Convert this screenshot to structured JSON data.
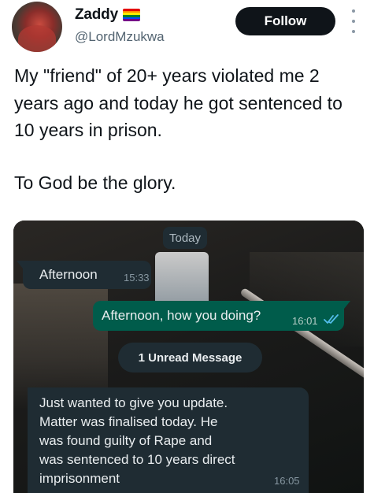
{
  "user": {
    "display_name": "Zaddy",
    "handle": "@LordMzukwa",
    "flag_icon": "rainbow-flag-icon",
    "flag_colors": [
      "#e40303",
      "#ff8c00",
      "#ffed00",
      "#008026",
      "#004dff",
      "#750787"
    ]
  },
  "actions": {
    "follow_label": "Follow",
    "more_icon": "more-vertical-icon"
  },
  "tweet": {
    "line1": "My \"friend\" of 20+ years violated me 2 years ago and today he got sentenced to 10 years in prison.",
    "line2": "To God be the glory."
  },
  "chat": {
    "date_chip": "Today",
    "messages": [
      {
        "direction": "incoming",
        "text": "Afternoon",
        "time": "15:33"
      },
      {
        "direction": "outgoing",
        "text": "Afternoon, how you doing?",
        "time": "16:01",
        "status_icon": "double-check-read-icon"
      },
      {
        "direction": "incoming",
        "text": "Just wanted to give you update.\nMatter was finalised today. He\nwas found guilty of Rape and\nwas sentenced to 10 years direct\nimprisonment",
        "time": "16:05"
      }
    ],
    "unread_label": "1 Unread Message"
  },
  "colors": {
    "follow_bg": "#0f1419",
    "incoming_bubble": "#1f2c33",
    "outgoing_bubble": "#005c4b",
    "read_tick": "#53bdeb"
  }
}
